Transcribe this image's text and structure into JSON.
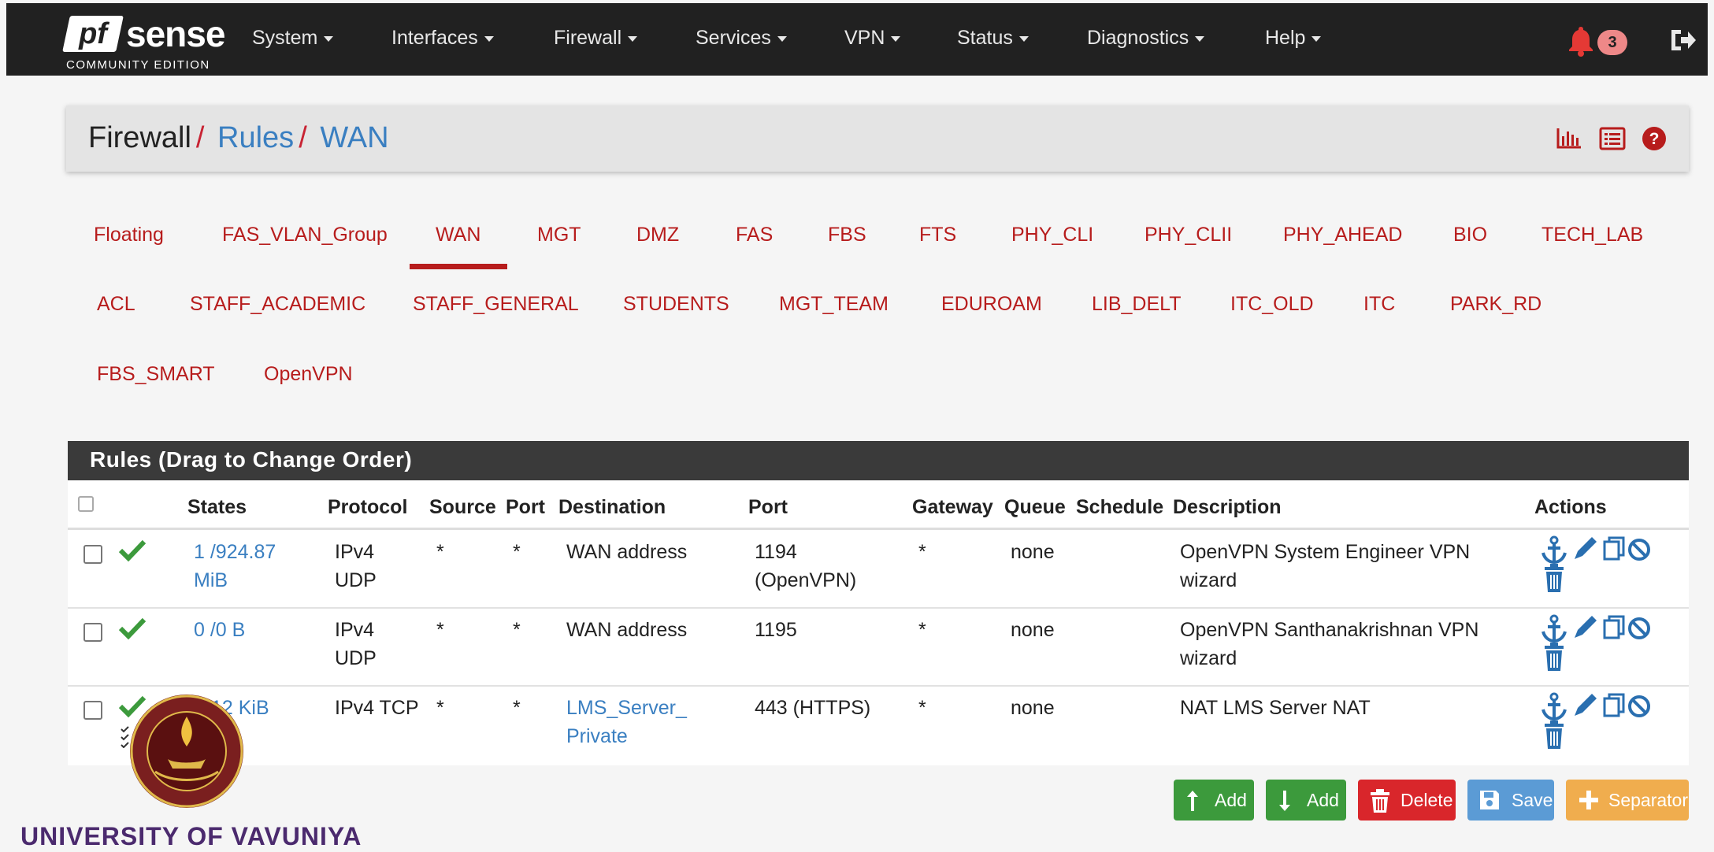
{
  "brand": {
    "logo_pf": "pf",
    "logo_sense": "sense",
    "edition": "COMMUNITY EDITION"
  },
  "nav": [
    {
      "label": "System"
    },
    {
      "label": "Interfaces"
    },
    {
      "label": "Firewall"
    },
    {
      "label": "Services"
    },
    {
      "label": "VPN"
    },
    {
      "label": "Status"
    },
    {
      "label": "Diagnostics"
    },
    {
      "label": "Help"
    }
  ],
  "notifications": {
    "count": "3"
  },
  "breadcrumb": {
    "root": "Firewall",
    "sep": "/",
    "rules": "Rules",
    "current": "WAN"
  },
  "tabs": {
    "row1": [
      "Floating",
      "FAS_VLAN_Group",
      "WAN",
      "MGT",
      "DMZ",
      "FAS",
      "FBS",
      "FTS",
      "PHY_CLI",
      "PHY_CLII",
      "PHY_AHEAD",
      "BIO",
      "TECH_LAB"
    ],
    "row2": [
      "ACL",
      "STAFF_ACADEMIC",
      "STAFF_GENERAL",
      "STUDENTS",
      "MGT_TEAM",
      "EDUROAM",
      "LIB_DELT",
      "ITC_OLD",
      "ITC",
      "PARK_RD"
    ],
    "row3": [
      "FBS_SMART",
      "OpenVPN"
    ],
    "active": "WAN"
  },
  "rules": {
    "title": "Rules (Drag to Change Order)",
    "columns": {
      "states": "States",
      "protocol": "Protocol",
      "source": "Source",
      "port": "Port",
      "destination": "Destination",
      "dport": "Port",
      "gateway": "Gateway",
      "queue": "Queue",
      "schedule": "Schedule",
      "description": "Description",
      "actions": "Actions"
    },
    "rows": [
      {
        "states1": "1 /924.87",
        "states2": "MiB",
        "proto1": "IPv4",
        "proto2": "UDP",
        "source": "*",
        "sport": "*",
        "dest1": "WAN address",
        "dest2": "",
        "dport1": "1194",
        "dport2": "(OpenVPN)",
        "gateway": "*",
        "queue": "none",
        "schedule": "",
        "desc1": "OpenVPN System Engineer VPN",
        "desc2": "wizard"
      },
      {
        "states1": "0 /0 B",
        "states2": "",
        "proto1": "IPv4",
        "proto2": "UDP",
        "source": "*",
        "sport": "*",
        "dest1": "WAN address",
        "dest2": "",
        "dport1": "1195",
        "dport2": "",
        "gateway": "*",
        "queue": "none",
        "schedule": "",
        "desc1": "OpenVPN Santhanakrishnan VPN",
        "desc2": "wizard"
      },
      {
        "states1": "12 KiB",
        "states2": "",
        "proto1": "IPv4 TCP",
        "proto2": "",
        "source": "*",
        "sport": "*",
        "dest1": "LMS_Server_",
        "dest2": "Private",
        "dport1": "443 (HTTPS)",
        "dport2": "",
        "gateway": "*",
        "queue": "none",
        "schedule": "",
        "desc1": "NAT LMS Server NAT",
        "desc2": ""
      }
    ]
  },
  "buttons": {
    "add_top": "Add",
    "add_bottom": "Add",
    "delete": "Delete",
    "save": "Save",
    "separator": "Separator"
  },
  "colors": {
    "navbar": "#212121",
    "accent_red": "#b71c1c",
    "link_blue": "#3a7fc1",
    "success": "#3c9a3c",
    "danger": "#d9262b",
    "info": "#5b9bd5",
    "warning": "#f0ad4e"
  },
  "university": {
    "name": "UNIVERSITY OF VAVUNIYA"
  }
}
